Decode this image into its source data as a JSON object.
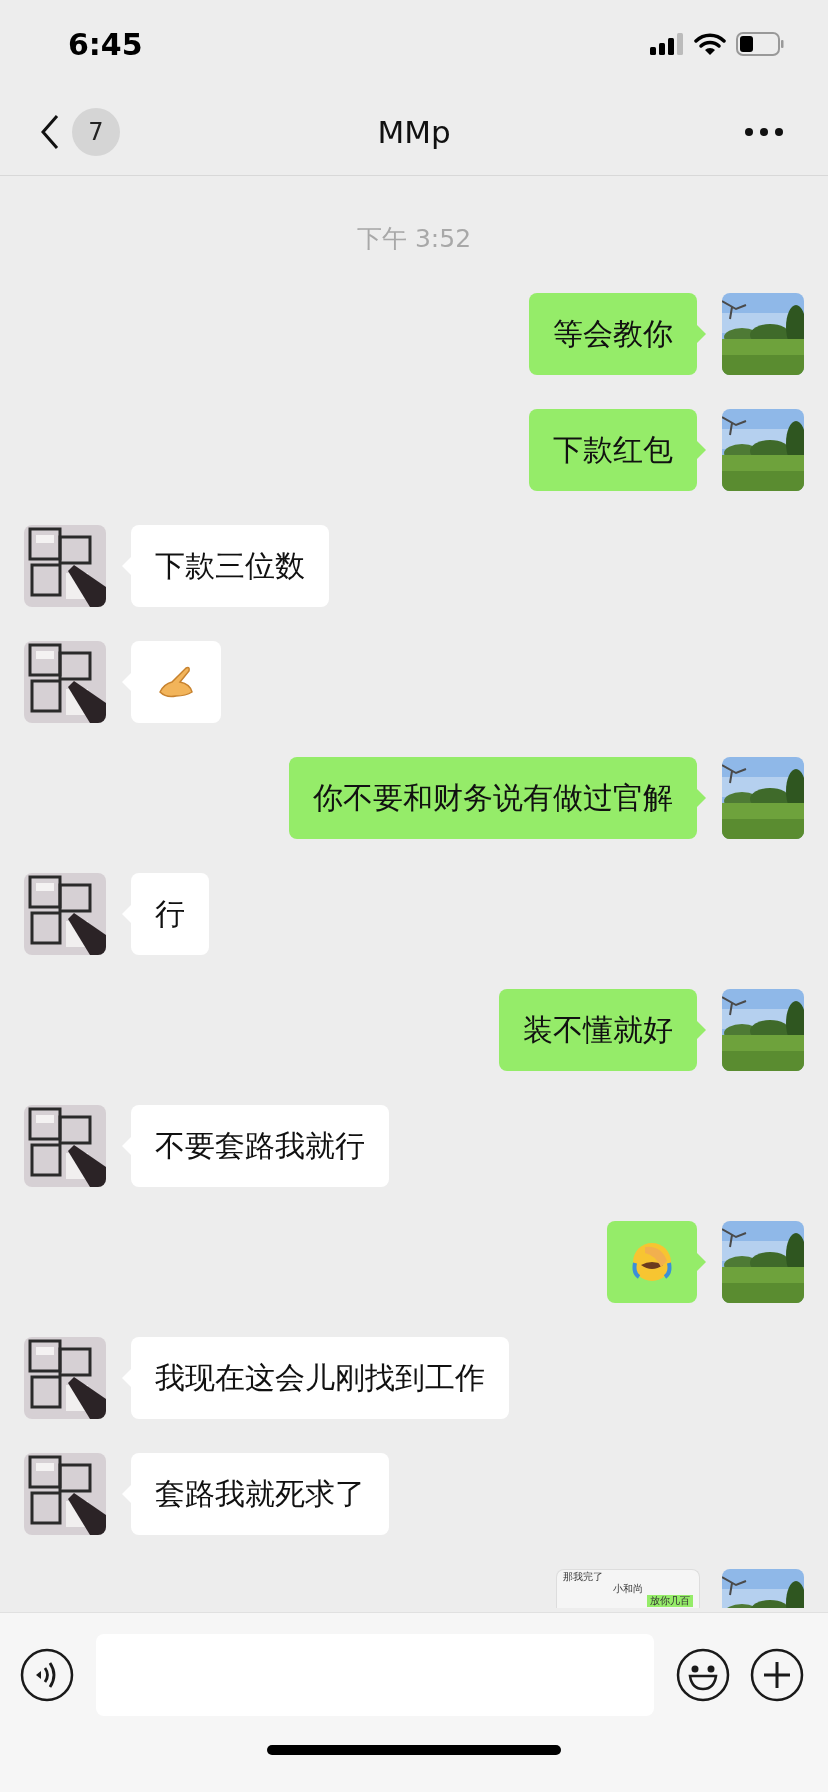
{
  "status_bar": {
    "time": "6:45"
  },
  "nav": {
    "back_count": "7",
    "title": "MMp"
  },
  "timestamp": "下午 3:52",
  "messages": [
    {
      "outgoing": true,
      "kind": "text",
      "text": "等会教你"
    },
    {
      "outgoing": true,
      "kind": "text",
      "text": "下款红包"
    },
    {
      "outgoing": false,
      "kind": "text",
      "text": "下款三位数"
    },
    {
      "outgoing": false,
      "kind": "hand"
    },
    {
      "outgoing": true,
      "kind": "text",
      "text": "你不要和财务说有做过官解"
    },
    {
      "outgoing": false,
      "kind": "text",
      "text": "行"
    },
    {
      "outgoing": true,
      "kind": "text",
      "text": "装不懂就好"
    },
    {
      "outgoing": false,
      "kind": "text",
      "text": "不要套路我就行"
    },
    {
      "outgoing": true,
      "kind": "facepalm"
    },
    {
      "outgoing": false,
      "kind": "text",
      "text": "我现在这会儿刚找到工作"
    },
    {
      "outgoing": false,
      "kind": "text",
      "text": "套路我就死求了"
    },
    {
      "outgoing": true,
      "kind": "screenshot",
      "screenshot": {
        "notice": "那我完了",
        "title": "小和尚",
        "bubble": "放你几百"
      }
    }
  ]
}
